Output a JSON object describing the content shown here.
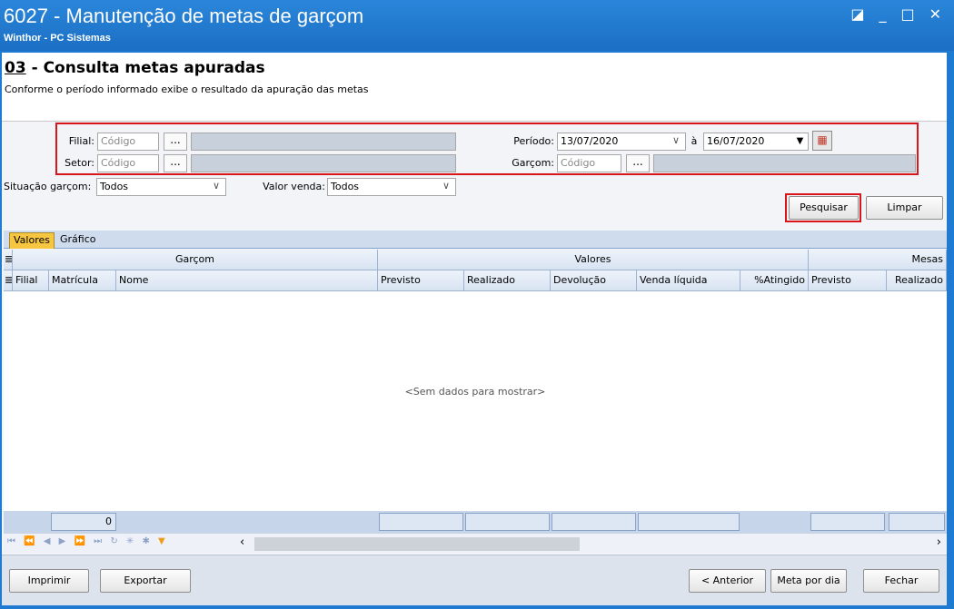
{
  "window": {
    "title": "6027 - Manutenção de metas de garçom",
    "subtitle": "Winthor - PC Sistemas",
    "controls": [
      "◪",
      "_",
      "□",
      "✕"
    ]
  },
  "header": {
    "step_number": "03",
    "step_title": " - Consulta metas apuradas",
    "step_desc": "Conforme o período informado exibe o resultado da apuração das metas"
  },
  "filters": {
    "filial_label": "Filial:",
    "filial_placeholder": "Código",
    "setor_label": "Setor:",
    "setor_placeholder": "Código",
    "periodo_label": "Período:",
    "periodo_start": "13/07/2020",
    "periodo_sep": "à",
    "periodo_end": "16/07/2020",
    "garcom_label": "Garçom:",
    "garcom_placeholder": "Código",
    "dots": "...",
    "situacao_label": "Situação garçom:",
    "situacao_value": "Todos",
    "valor_venda_label": "Valor venda:",
    "valor_venda_value": "Todos"
  },
  "actions": {
    "pesquisar": "Pesquisar",
    "limpar": "Limpar"
  },
  "tabs": [
    "Valores",
    "Gráfico"
  ],
  "grid": {
    "bands": [
      "Garçom",
      "Valores",
      "Mesas"
    ],
    "columns": [
      "Filial",
      "Matrícula",
      "Nome",
      "Previsto",
      "Realizado",
      "Devolução",
      "Venda líquida",
      "%Atingido",
      "Previsto",
      "Realizado"
    ],
    "empty_text": "<Sem dados para mostrar>",
    "footer_count": "0"
  },
  "bottom_buttons": {
    "imprimir": "Imprimir",
    "exportar": "Exportar",
    "anterior": "< Anterior",
    "meta_por_dia": "Meta por dia",
    "fechar": "Fechar"
  },
  "colors": {
    "title_bar": "#1b6fc4",
    "highlight": "#d9151b",
    "active_tab": "#f7c640"
  }
}
